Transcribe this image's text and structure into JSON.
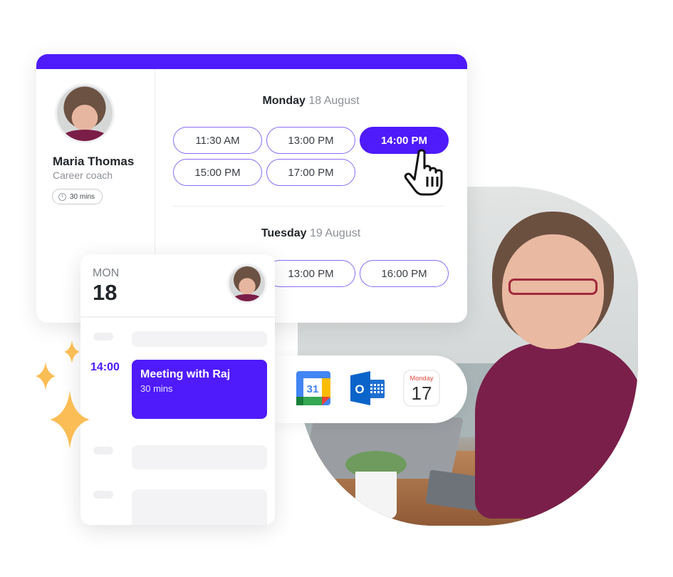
{
  "brand": {
    "accent": "#4f1bfb",
    "sparkle": "#fbbd55"
  },
  "profile": {
    "name": "Maria Thomas",
    "role": "Career coach",
    "duration": "30 mins",
    "duration_icon": "clock-icon"
  },
  "schedule": [
    {
      "day": "Monday",
      "date": "18 August",
      "slots": [
        {
          "label": "11:30 AM",
          "selected": false
        },
        {
          "label": "13:00 PM",
          "selected": false
        },
        {
          "label": "14:00 PM",
          "selected": true
        },
        {
          "label": "15:00 PM",
          "selected": false
        },
        {
          "label": "17:00 PM",
          "selected": false
        }
      ]
    },
    {
      "day": "Tuesday",
      "date": "19 August",
      "slots": [
        {
          "label": "13:00 PM",
          "selected": false
        },
        {
          "label": "16:00 PM",
          "selected": false
        }
      ]
    }
  ],
  "day_view": {
    "dow": "MON",
    "day_number": "18",
    "event": {
      "time": "14:00",
      "title": "Meeting with Raj",
      "duration": "30 mins"
    }
  },
  "integrations": [
    {
      "name": "google-calendar",
      "label": "31"
    },
    {
      "name": "outlook-calendar",
      "label": "O"
    },
    {
      "name": "apple-calendar",
      "weekday": "Monday",
      "day": "17"
    }
  ]
}
